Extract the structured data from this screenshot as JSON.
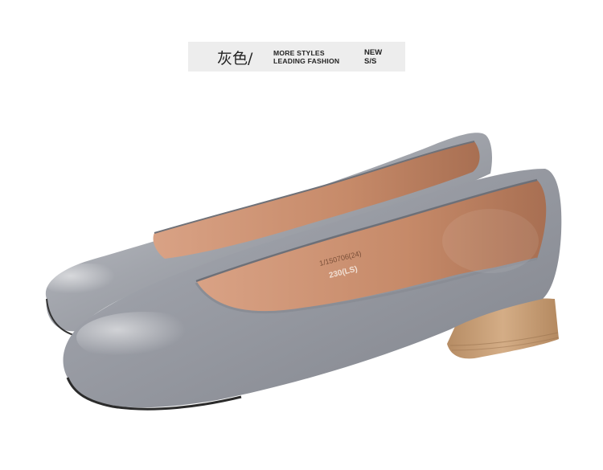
{
  "banner": {
    "color_name": "灰色",
    "separator": "/",
    "tagline_line1": "MORE STYLES",
    "tagline_line2": "LEADING FASHION",
    "season_line1": "NEW",
    "season_line2": "S/S"
  },
  "product": {
    "insole_print_line1": "1/150706(24)",
    "insole_print_line2": "230(LS)",
    "colors": {
      "leather": "#9a9ca3",
      "lining": "#c98c6b",
      "heel": "#c7a078",
      "banner_bg": "#ededed"
    }
  }
}
